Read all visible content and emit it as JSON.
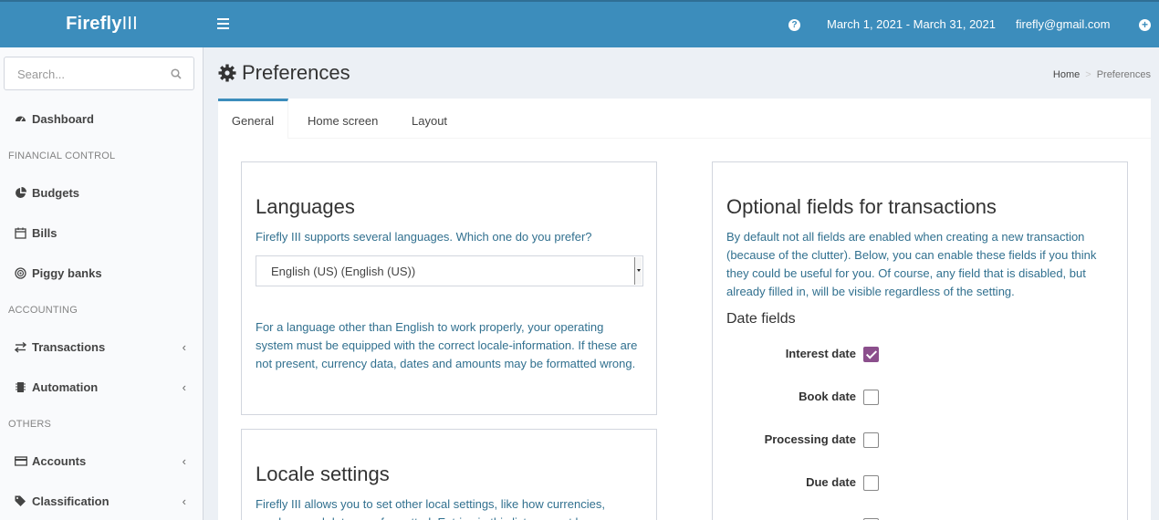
{
  "header": {
    "logo_bold": "Firefly",
    "logo_thin": "III",
    "date_range": "March 1, 2021 - March 31, 2021",
    "user_email": "firefly@gmail.com"
  },
  "sidebar": {
    "search_placeholder": "Search...",
    "items": [
      {
        "label": "Dashboard",
        "icon": "dashboard-icon"
      },
      {
        "header": "FINANCIAL CONTROL"
      },
      {
        "label": "Budgets",
        "icon": "pie-chart-icon"
      },
      {
        "label": "Bills",
        "icon": "calendar-icon"
      },
      {
        "label": "Piggy banks",
        "icon": "bullseye-icon"
      },
      {
        "header": "ACCOUNTING"
      },
      {
        "label": "Transactions",
        "icon": "exchange-icon"
      },
      {
        "label": "Automation",
        "icon": "microchip-icon"
      },
      {
        "header": "OTHERS"
      },
      {
        "label": "Accounts",
        "icon": "credit-card-icon"
      },
      {
        "label": "Classification",
        "icon": "tags-icon"
      }
    ]
  },
  "page": {
    "title": "Preferences",
    "breadcrumb": [
      "Home",
      "Preferences"
    ]
  },
  "tabs": [
    "General",
    "Home screen",
    "Layout"
  ],
  "languages": {
    "title": "Languages",
    "help": "Firefly III supports several languages. Which one do you prefer?",
    "selected": "English (US) (English (US))",
    "note": "For a language other than English to work properly, your operating system must be equipped with the correct locale-information. If these are not present, currency data, dates and amounts may be formatted wrong."
  },
  "locale": {
    "title": "Locale settings",
    "help": "Firefly III allows you to set other local settings, like how currencies, numbers and dates are formatted. Entries in this list may not be"
  },
  "optional_fields": {
    "title": "Optional fields for transactions",
    "help": "By default not all fields are enabled when creating a new transaction (because of the clutter). Below, you can enable these fields if you think they could be useful for you. Of course, any field that is disabled, but already filled in, will be visible regardless of the setting.",
    "date_fields_title": "Date fields",
    "date_fields": [
      {
        "label": "Interest date",
        "checked": true
      },
      {
        "label": "Book date",
        "checked": false
      },
      {
        "label": "Processing date",
        "checked": false
      },
      {
        "label": "Due date",
        "checked": false
      }
    ]
  },
  "colors": {
    "header": "#3c8dbc",
    "checkbox_checked": "#8b4f8c",
    "help_text": "#31708f"
  }
}
